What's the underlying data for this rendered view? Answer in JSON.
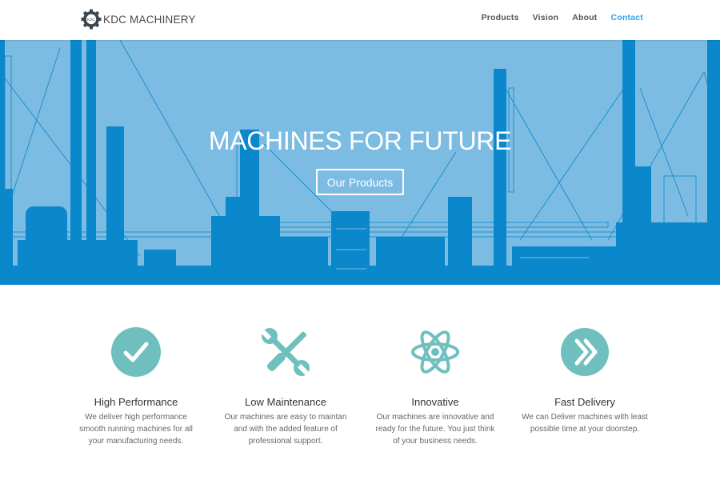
{
  "brand": {
    "name": "KDC MACHINERY",
    "badge": "KDC"
  },
  "nav": [
    {
      "label": "Products"
    },
    {
      "label": "Vision"
    },
    {
      "label": "About"
    },
    {
      "label": "Contact"
    }
  ],
  "hero": {
    "title": "MACHINES FOR FUTURE",
    "button": "Our Products"
  },
  "features": [
    {
      "icon": "checkmark-circle-icon",
      "title": "High Performance",
      "desc": "We deliver high performance smooth running machines for all your manufacturing needs."
    },
    {
      "icon": "wrench-screwdriver-icon",
      "title": "Low Maintenance",
      "desc": "Our machines are easy to maintan and with the added feature of professional support."
    },
    {
      "icon": "atom-icon",
      "title": "Innovative",
      "desc": "Our machines are innovative and ready for the future. You just think of your business needs."
    },
    {
      "icon": "double-chevron-right-icon",
      "title": "Fast Delivery",
      "desc": "We can Deliver machines with least possible time at your doorstep."
    }
  ],
  "colors": {
    "accent": "#2ea3f2",
    "hero_bg": "#7dbce2",
    "hero_fg": "#0b87cb",
    "icon": "#6fbfbf"
  }
}
